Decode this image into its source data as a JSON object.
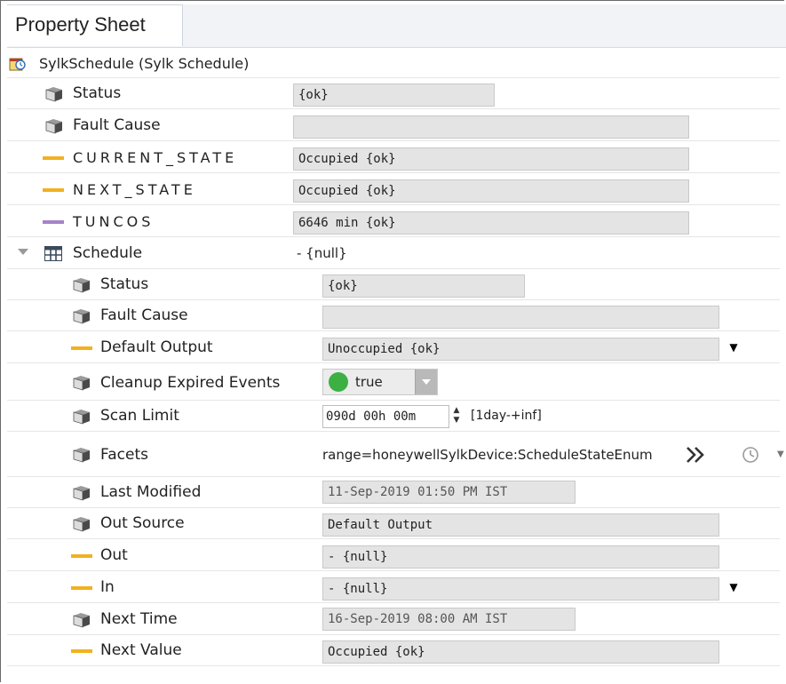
{
  "tab": {
    "title": "Property Sheet"
  },
  "root": {
    "label": "SylkSchedule  (Sylk Schedule)",
    "icon": "schedule-icon"
  },
  "top_rows": [
    {
      "label": "Status",
      "value": "{ok}",
      "icon": "component-cube-icon"
    },
    {
      "label": "Fault Cause",
      "value": "",
      "icon": "component-cube-icon"
    },
    {
      "label": "CURRENT_STATE",
      "value": "Occupied {ok}",
      "icon": "enum-slot-icon",
      "color": "#f3b11f"
    },
    {
      "label": "NEXT_STATE",
      "value": "Occupied {ok}",
      "icon": "enum-slot-icon",
      "color": "#f3b11f"
    },
    {
      "label": "TUNCOS",
      "value": "6646 min {ok}",
      "icon": "numeric-slot-icon",
      "color": "#a583c9"
    }
  ],
  "schedule": {
    "label": "Schedule",
    "value": "- {null}",
    "icon": "grid-icon",
    "rows": {
      "status": {
        "label": "Status",
        "value": "{ok}"
      },
      "fault_cause": {
        "label": "Fault Cause",
        "value": ""
      },
      "default_output": {
        "label": "Default Output",
        "value": "Unoccupied {ok}"
      },
      "cleanup": {
        "label": "Cleanup Expired Events",
        "value": "true"
      },
      "scan_limit": {
        "label": "Scan Limit",
        "value": "090d 00h 00m",
        "range": "[1day-+inf]"
      },
      "facets": {
        "label": "Facets",
        "value": "range=honeywellSylkDevice:ScheduleStateEnum"
      },
      "last_modified": {
        "label": "Last Modified",
        "value": "11-Sep-2019 01:50 PM IST"
      },
      "out_source": {
        "label": "Out Source",
        "value": "Default Output"
      },
      "out": {
        "label": "Out",
        "value": "- {null}"
      },
      "in": {
        "label": "In",
        "value": "- {null}"
      },
      "next_time": {
        "label": "Next Time",
        "value": "16-Sep-2019 08:00 AM IST"
      },
      "next_value": {
        "label": "Next Value",
        "value": "Occupied {ok}"
      }
    }
  },
  "colors": {
    "enum_slot": "#f3b11f",
    "numeric_slot": "#a583c9",
    "true_dot": "#3cb043",
    "field_bg": "#e4e4e4"
  }
}
